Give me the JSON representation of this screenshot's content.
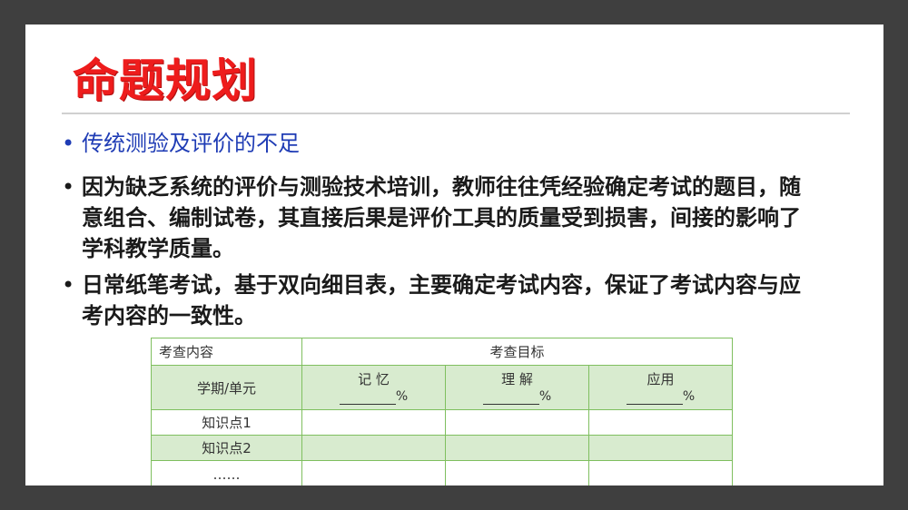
{
  "slide": {
    "title": "命题规划",
    "bullets": [
      {
        "marker": "•",
        "text": "传统测验及评价的不足"
      },
      {
        "marker": "•",
        "text": "因为缺乏系统的评价与测验技术培训，教师往往凭经验确定考试的题目，随意组合、编制试卷，其直接后果是评价工具的质量受到损害，间接的影响了学科教学质量。"
      },
      {
        "marker": "•",
        "text": "日常纸笔考试，基于双向细目表，主要确定考试内容，保证了考试内容与应考内容的一致性。"
      }
    ]
  },
  "table": {
    "header_left": "考查内容",
    "header_right": "考查目标",
    "sub_left": "学期/单元",
    "levels": [
      {
        "label": "记 忆",
        "unit": "%"
      },
      {
        "label": "理 解",
        "unit": "%"
      },
      {
        "label": "应用",
        "unit": "%"
      }
    ],
    "rows": [
      "知识点1",
      "知识点2",
      "……"
    ]
  },
  "colors": {
    "title": "#ee1c1c",
    "bullet_blue": "#1f3cb5",
    "table_border": "#7fbf5f",
    "table_fill": "#d8ebcf",
    "frame": "#3f3f3f"
  }
}
